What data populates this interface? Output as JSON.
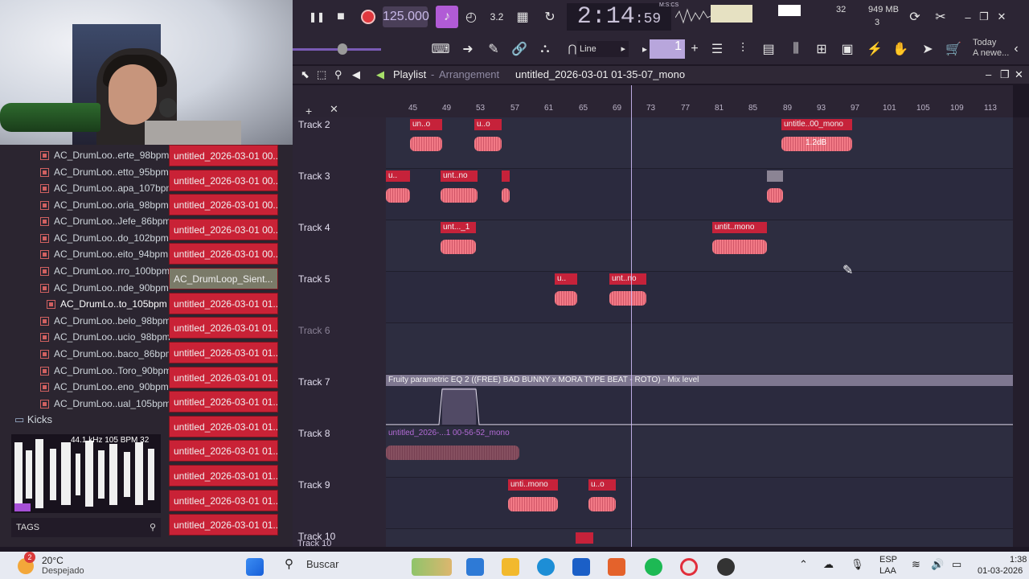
{
  "toolbar": {
    "tempo": "125.000",
    "time_main": "2:14",
    "time_sub": "59",
    "time_label": "M:S:CS",
    "cpu": "32",
    "memory": "949 MB",
    "voices": "3",
    "snap_label": "Line",
    "hint_date": "Today",
    "hint_text": "A newe...",
    "pattern_number": "1"
  },
  "playlist": {
    "title": "Playlist",
    "subtitle": "Arrangement",
    "project": "untitled_2026-03-01 01-35-07_mono",
    "ticks": [
      "45",
      "49",
      "53",
      "57",
      "61",
      "65",
      "69",
      "73",
      "77",
      "81",
      "85",
      "89",
      "93",
      "97",
      "101",
      "105",
      "109",
      "113"
    ],
    "tracks": [
      "Track 2",
      "Track 3",
      "Track 4",
      "Track 5",
      "Track 6",
      "Track 7",
      "Track 8",
      "Track 9",
      "Track 10"
    ],
    "footer_track": "Track 10",
    "clips": {
      "t2a": "un..o",
      "t2b": "u..o",
      "t2c": "untitle..00_mono",
      "t2c_gain": "1.2dB",
      "t3a": "u..",
      "t3b": "unt..no",
      "t3c": "",
      "t3d": "",
      "t4a": "unt..._1",
      "t4b": "untit..mono",
      "t5a": "u..",
      "t5b": "unt..no",
      "t9a": "unti..mono",
      "t9b": "u..o",
      "t8a": "untitled_2026-...1 00-56-52_mono"
    },
    "automation_label": "Fruity parametric EQ 2 ((FREE) BAD BUNNY x MORA TYPE BEAT - ROTO) - Mix level"
  },
  "browser": {
    "items": [
      "AC_DrumLoo..erte_98bpm",
      "AC_DrumLoo..etto_95bpm",
      "AC_DrumLoo..apa_107bpm",
      "AC_DrumLoo..oria_98bpm",
      "AC_DrumLoo..Jefe_86bpm",
      "AC_DrumLoo..do_102bpm",
      "AC_DrumLoo..eito_94bpm",
      "AC_DrumLoo..rro_100bpm",
      "AC_DrumLoo..nde_90bpm",
      "AC_DrumLo..to_105bpm",
      "AC_DrumLoo..belo_98bpm",
      "AC_DrumLoo..ucio_98bpm",
      "AC_DrumLoo..baco_86bpm",
      "AC_DrumLoo..Toro_90bpm",
      "AC_DrumLoo..eno_90bpm",
      "AC_DrumLoo..ual_105bpm"
    ],
    "folder": "Kicks",
    "wave_info": "44.1 kHz 105 BPM 32",
    "tags": "TAGS",
    "channels": [
      "untitled_2026-03-01 00...",
      "untitled_2026-03-01 00...",
      "untitled_2026-03-01 00...",
      "untitled_2026-03-01 00...",
      "untitled_2026-03-01 00...",
      "AC_DrumLoop_Sient...",
      "untitled_2026-03-01 01...",
      "untitled_2026-03-01 01...",
      "untitled_2026-03-01 01...",
      "untitled_2026-03-01 01...",
      "untitled_2026-03-01 01...",
      "untitled_2026-03-01 01...",
      "untitled_2026-03-01 01...",
      "untitled_2026-03-01 01...",
      "untitled_2026-03-01 01...",
      "untitled_2026-03-01 01..."
    ]
  },
  "taskbar": {
    "weather_temp": "20°C",
    "weather_desc": "Despejado",
    "weather_badge": "2",
    "search": "Buscar",
    "lang1": "ESP",
    "lang2": "LAA",
    "clock_time": "1:38",
    "clock_date": "01-03-2026"
  }
}
